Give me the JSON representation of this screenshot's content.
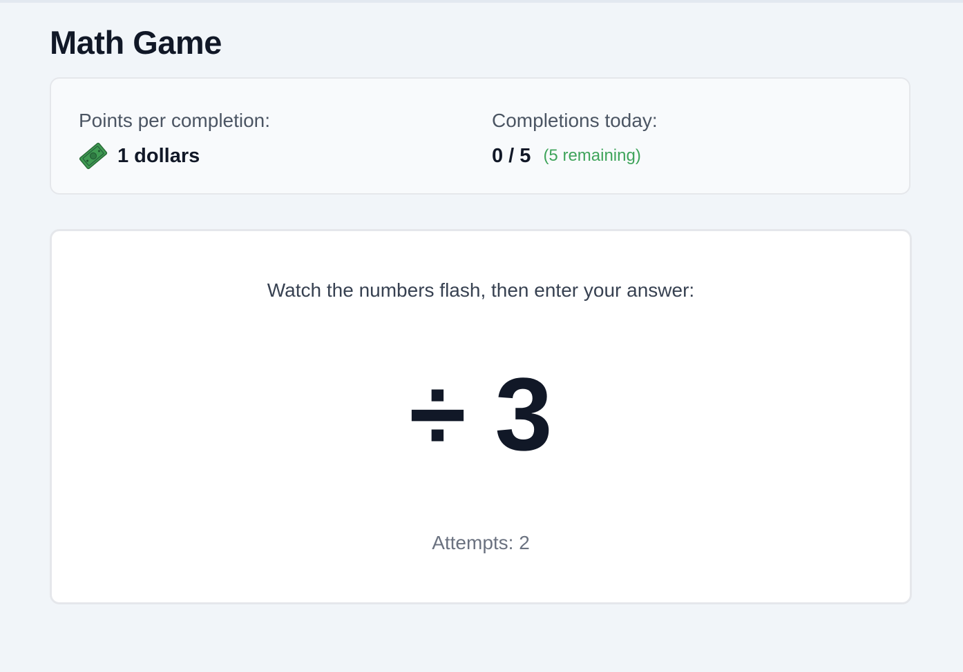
{
  "page": {
    "title": "Math Game"
  },
  "stats": {
    "points_label": "Points per completion:",
    "points_value": "1 dollars",
    "points_icon": "money-bill-icon",
    "completions_label": "Completions today:",
    "completions_value": "0 / 5",
    "completions_remaining": "(5 remaining)",
    "remaining_color": "#3fa45b"
  },
  "game": {
    "instruction": "Watch the numbers flash, then enter your answer:",
    "flash_display": "÷ 3",
    "attempts_label": "Attempts: 2"
  }
}
